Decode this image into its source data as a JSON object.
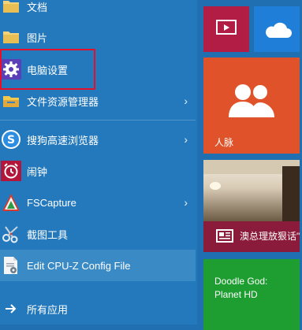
{
  "menu": {
    "items": [
      {
        "label": "文档",
        "icon": "folder-icon",
        "arrow": false
      },
      {
        "label": "图片",
        "icon": "folder-icon",
        "arrow": false
      },
      {
        "label": "电脑设置",
        "icon": "gear-icon",
        "arrow": false
      },
      {
        "label": "文件资源管理器",
        "icon": "file-explorer-icon",
        "arrow": true
      },
      {
        "label": "搜狗高速浏览器",
        "icon": "sogou-browser-icon",
        "arrow": true
      },
      {
        "label": "闹钟",
        "icon": "alarm-clock-icon",
        "arrow": false
      },
      {
        "label": "FSCapture",
        "icon": "fscapture-icon",
        "arrow": true
      },
      {
        "label": "截图工具",
        "icon": "scissors-icon",
        "arrow": false
      },
      {
        "label": "Edit CPU-Z Config File",
        "icon": "document-gear-icon",
        "arrow": false
      }
    ],
    "all_apps": {
      "label": "所有应用",
      "icon": "arrow-right-icon"
    }
  },
  "tiles": {
    "video": {
      "icon": "video-icon",
      "color": "#b21d46"
    },
    "onedrive": {
      "icon": "cloud-icon",
      "color": "#1f7fd8"
    },
    "people": {
      "label": "人脉",
      "icon": "people-icon",
      "color": "#e0532a"
    },
    "news": {
      "label": "澳总理放狠话\"",
      "icon": "news-icon",
      "color": "#8a1b3a"
    },
    "game": {
      "label_line1": "Doodle God:",
      "label_line2": "Planet HD",
      "color": "#1e9e31"
    }
  }
}
